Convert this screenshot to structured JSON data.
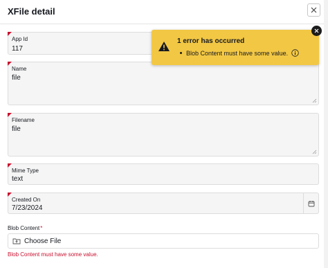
{
  "dialog": {
    "title": "XFile detail",
    "close_icon": "close-icon"
  },
  "fields": {
    "app_id": {
      "label": "App Id",
      "value": "117"
    },
    "name": {
      "label": "Name",
      "value": "file"
    },
    "filename": {
      "label": "Filename",
      "value": "file"
    },
    "mime_type": {
      "label": "Mime Type",
      "value": "text"
    },
    "created_on": {
      "label": "Created On",
      "value": "7/23/2024",
      "icon": "calendar-icon"
    },
    "blob_content": {
      "label": "Blob Content",
      "required_marker": "*",
      "button_label": "Choose File",
      "icon": "file-upload-icon",
      "error": "Blob Content must have some value."
    }
  },
  "error_toast": {
    "title": "1 error has occurred",
    "messages": [
      "Blob Content must have some value."
    ],
    "icon": "warning-icon",
    "info_icon": "info-icon",
    "close_icon": "close-icon"
  },
  "colors": {
    "required": "#c8102e",
    "toast_bg": "#f2c744",
    "field_bg": "#f5f5f5",
    "error_text": "#c8102e"
  }
}
